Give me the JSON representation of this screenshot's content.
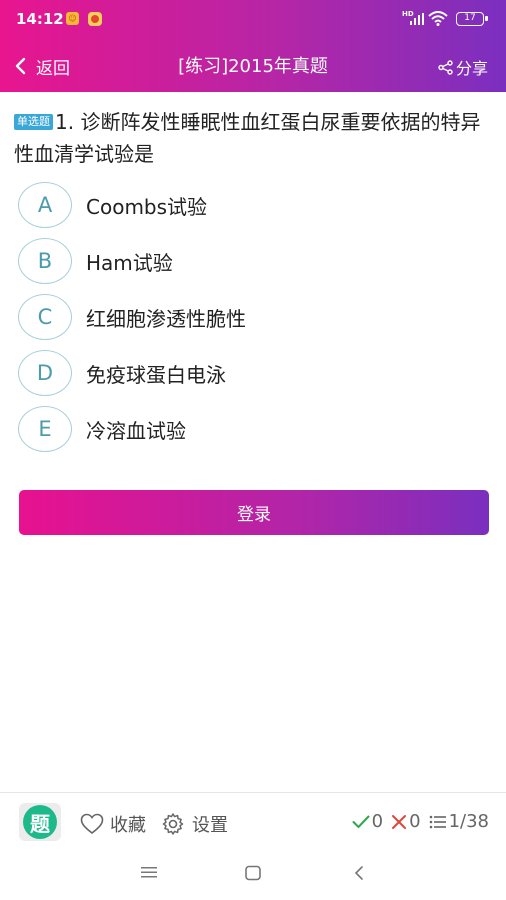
{
  "status": {
    "time": "14:12",
    "network_badge": "HD",
    "battery": "17"
  },
  "header": {
    "back_label": "返回",
    "title": "[练习]2015年真题",
    "share_label": "分享"
  },
  "question": {
    "type_tag": "单选题",
    "text": "1. 诊断阵发性睡眠性血红蛋白尿重要依据的特异性血清学试验是"
  },
  "options": [
    {
      "letter": "A",
      "text": "Coombs试验"
    },
    {
      "letter": "B",
      "text": "Ham试验"
    },
    {
      "letter": "C",
      "text": "红细胞渗透性脆性"
    },
    {
      "letter": "D",
      "text": "免疫球蛋白电泳"
    },
    {
      "letter": "E",
      "text": "冷溶血试验"
    }
  ],
  "login_button": "登录",
  "bottom": {
    "favorite_label": "收藏",
    "settings_label": "设置",
    "correct_count": "0",
    "wrong_count": "0",
    "progress": "1/38"
  },
  "colors": {
    "accent_start": "#e8158f",
    "accent_end": "#7b2fbf",
    "option_circle": "#a7cfd8",
    "option_letter": "#4a9cad",
    "correct": "#2aa84a",
    "wrong": "#e0463a"
  }
}
